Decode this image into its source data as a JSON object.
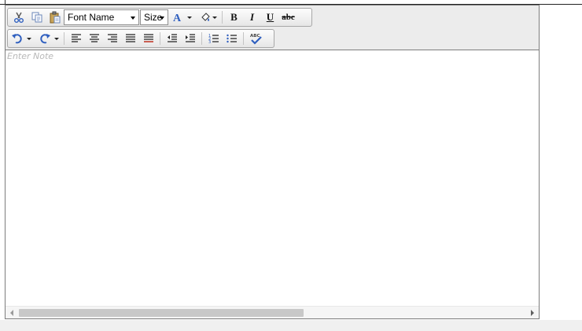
{
  "editor": {
    "placeholder": "Enter Note",
    "font_name_label": "Font Name",
    "size_label": "Size",
    "bold_label": "B",
    "italic_label": "I",
    "underline_label": "U",
    "strike_label": "abc"
  },
  "toolbar": {
    "row1_icons": [
      "cut-icon",
      "copy-icon",
      "paste-icon",
      "font-color-icon",
      "highlight-color-icon",
      "bold-icon",
      "italic-icon",
      "underline-icon",
      "strikethrough-icon"
    ],
    "row2_icons": [
      "undo-icon",
      "redo-icon",
      "align-left-icon",
      "align-center-icon",
      "align-right-icon",
      "justify-icon",
      "clear-format-icon",
      "outdent-icon",
      "indent-icon",
      "ordered-list-icon",
      "unordered-list-icon",
      "spellcheck-icon"
    ]
  },
  "colors": {
    "border": "#7d7d7d",
    "toolbar_bg": "#ececec",
    "icon_blue": "#2f5fbf",
    "placeholder": "#b8b8b8"
  }
}
